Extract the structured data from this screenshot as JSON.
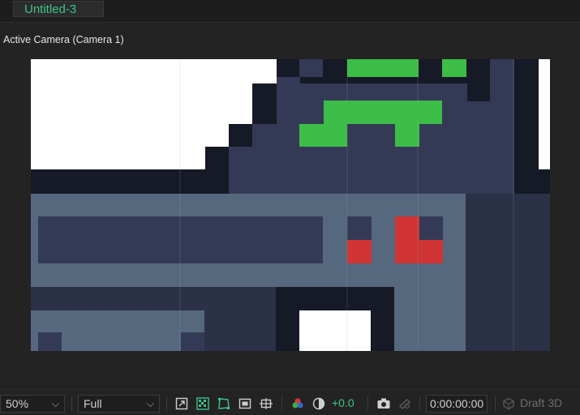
{
  "tab": {
    "title": "Untitled-3"
  },
  "viewer": {
    "camera_label": "Active Camera (Camera 1)"
  },
  "toolbar": {
    "zoom": "50%",
    "resolution": "Full",
    "exposure": "+0.0",
    "timecode": "0:00:00:00",
    "renderer": "Draft 3D"
  },
  "icons": [
    "region-of-interest-icon",
    "transparency-grid-icon",
    "mask-path-icon",
    "title-action-safe-icon",
    "grid-guides-icon",
    "color-channels-icon",
    "reset-exposure-icon",
    "snapshot-icon",
    "show-snapshot-icon",
    "draft-3d-icon"
  ],
  "colors": {
    "accent": "#3fc48a",
    "background": "#232323"
  }
}
